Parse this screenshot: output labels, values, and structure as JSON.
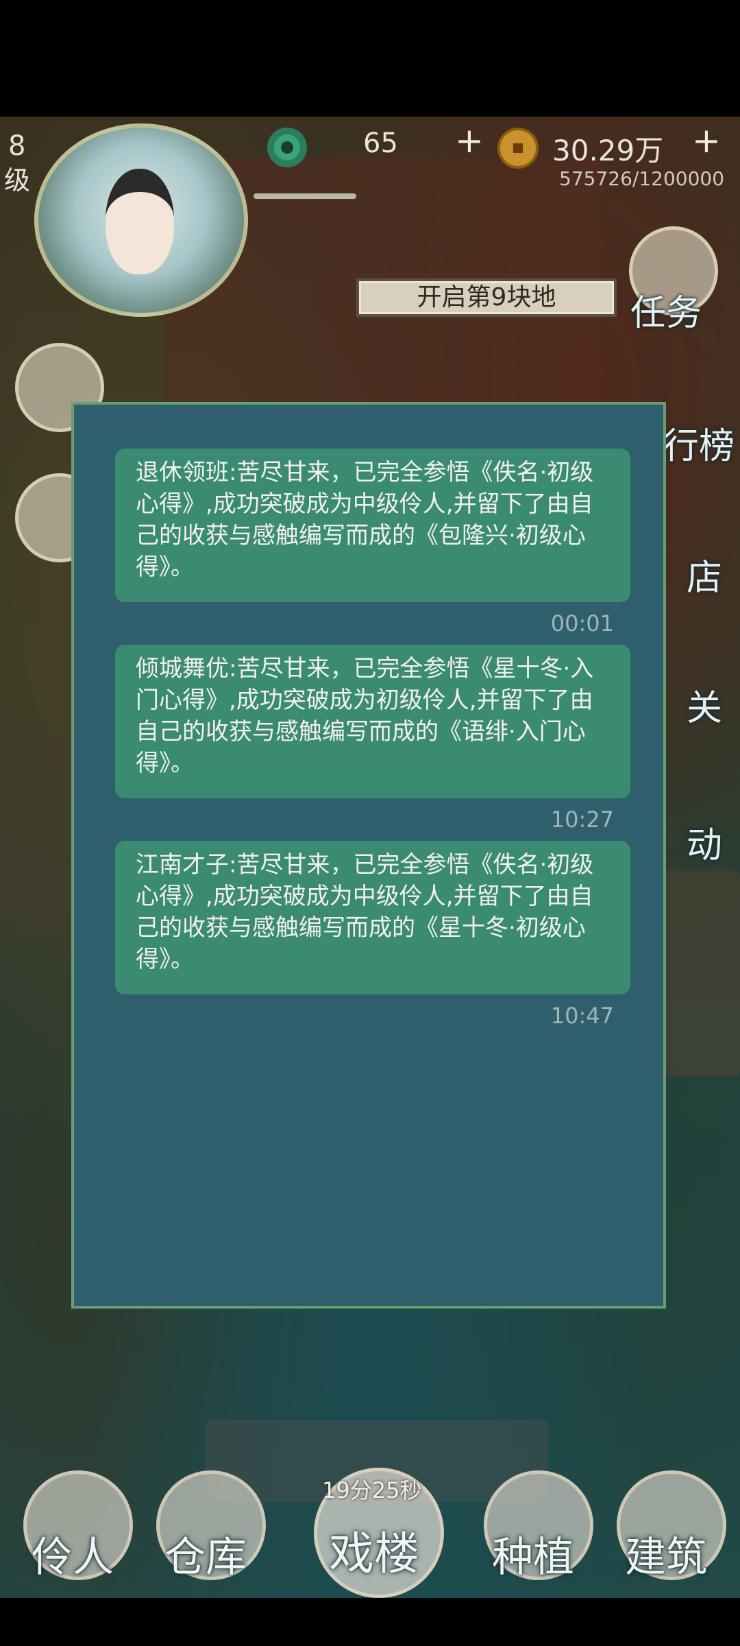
{
  "hud": {
    "level_num": "8",
    "level_label": "级",
    "jade_count": "65",
    "coin_count": "30.29万",
    "exp_text": "575726/1200000",
    "plus_symbol": "+"
  },
  "banner": {
    "text": "开启第9块地"
  },
  "side_menu": [
    {
      "label": "任务",
      "icon": "scroll-icon"
    },
    {
      "label": "行榜",
      "icon": "banner-icon"
    },
    {
      "label": "店",
      "icon": "cat-shop-icon"
    },
    {
      "label": "关",
      "icon": "drum-icon"
    },
    {
      "label": "动",
      "icon": "lantern-icon"
    }
  ],
  "messages": [
    {
      "text": "退休领班:苦尽甘来，已完全参悟《佚名·初级心得》,成功突破成为中级伶人,并留下了由自己的收获与感触编写而成的《包隆兴·初级心得》。",
      "time": "00:01"
    },
    {
      "text": "倾城舞优:苦尽甘来，已完全参悟《星十冬·入门心得》,成功突破成为初级伶人,并留下了由自己的收获与感触编写而成的《语绯·入门心得》。",
      "time": "10:27"
    },
    {
      "text": "江南才子:苦尽甘来，已完全参悟《佚名·初级心得》,成功突破成为中级伶人,并留下了由自己的收获与感触编写而成的《星十冬·初级心得》。",
      "time": "10:47"
    }
  ],
  "bottom_nav": {
    "items": [
      {
        "label": "伶人",
        "icon": "actor-icon"
      },
      {
        "label": "仓库",
        "icon": "warehouse-icon"
      },
      {
        "label": "戏楼",
        "icon": "theater-icon"
      },
      {
        "label": "种植",
        "icon": "plant-icon"
      },
      {
        "label": "建筑",
        "icon": "build-icon"
      }
    ],
    "timer": "19分25秒"
  }
}
